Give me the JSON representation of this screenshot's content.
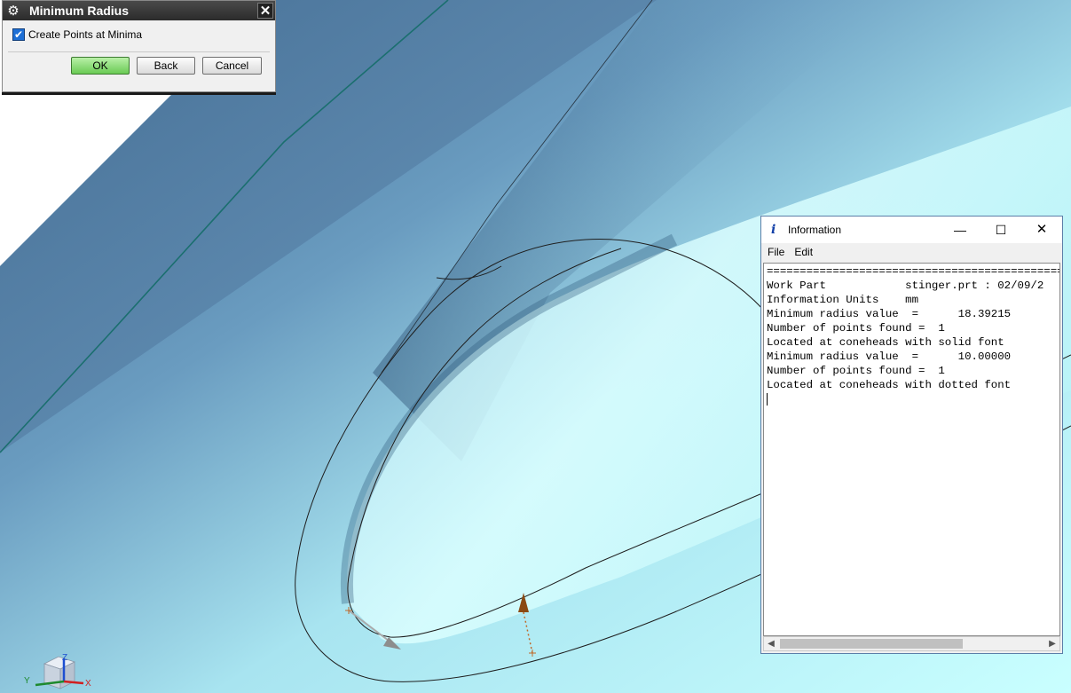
{
  "min_radius_dialog": {
    "title": "Minimum Radius",
    "checkbox_label": "Create Points at Minima",
    "checkbox_checked": true,
    "ok_label": "OK",
    "back_label": "Back",
    "cancel_label": "Cancel",
    "icons": {
      "settings": "gear-icon",
      "close": "close-icon"
    }
  },
  "info_window": {
    "title": "Information",
    "menu": [
      "File",
      "Edit"
    ],
    "lines": [
      "================================================",
      "Work Part            stinger.prt : 02/09/2",
      "Information Units    mm",
      "Minimum radius value  =      18.39215",
      "Number of points found =  1",
      "Located at coneheads with solid font",
      "Minimum radius value  =      10.00000",
      "Number of points found =  1",
      "Located at coneheads with dotted font"
    ],
    "icons": {
      "app": "info-icon",
      "minimize": "minimize-icon",
      "maximize": "maximize-icon",
      "close": "close-icon"
    }
  },
  "viewport": {
    "triad_labels": {
      "x": "X",
      "y": "Y",
      "z": "Z"
    },
    "colors": {
      "surface_dark": "#4f7ca3",
      "surface_light": "#c8ffff",
      "edge_green": "#1b6f6f",
      "cone_solid": "#aaaaaa",
      "cone_dotted": "#8a4a14"
    }
  }
}
